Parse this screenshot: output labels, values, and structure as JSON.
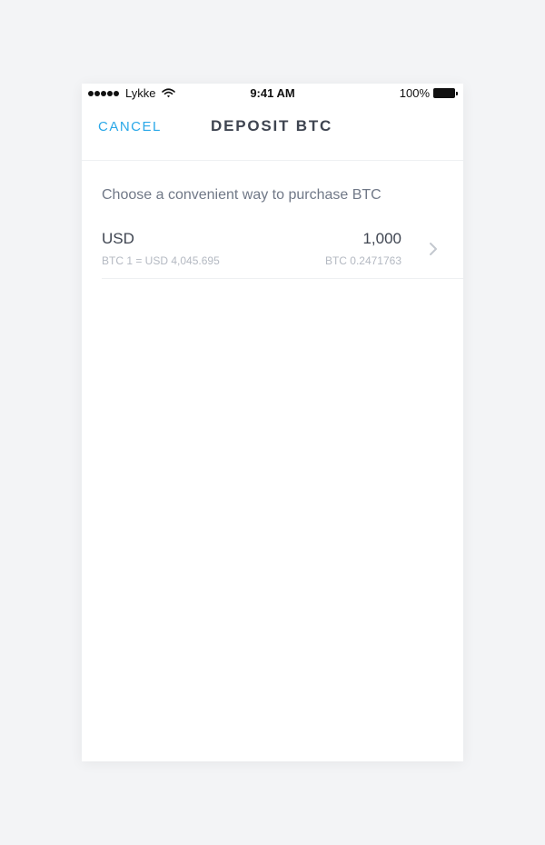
{
  "status_bar": {
    "carrier": "Lykke",
    "time": "9:41 AM",
    "battery": "100%",
    "icons": [
      "signal-dots-icon",
      "wifi-icon",
      "battery-icon"
    ]
  },
  "nav": {
    "cancel_label": "CANCEL",
    "title": "DEPOSIT BTC"
  },
  "content": {
    "prompt": "Choose a convenient way to purchase BTC",
    "options": [
      {
        "currency": "USD",
        "rate": "BTC 1 = USD 4,045.695",
        "amount": "1,000",
        "btc_amount": "BTC 0.2471763",
        "icon": "chevron-right-icon"
      }
    ]
  },
  "colors": {
    "accent": "#2aa8e8",
    "text_primary": "#3f4551",
    "text_secondary": "#707887",
    "text_muted": "#b4b9c2",
    "background": "#f3f4f6"
  }
}
